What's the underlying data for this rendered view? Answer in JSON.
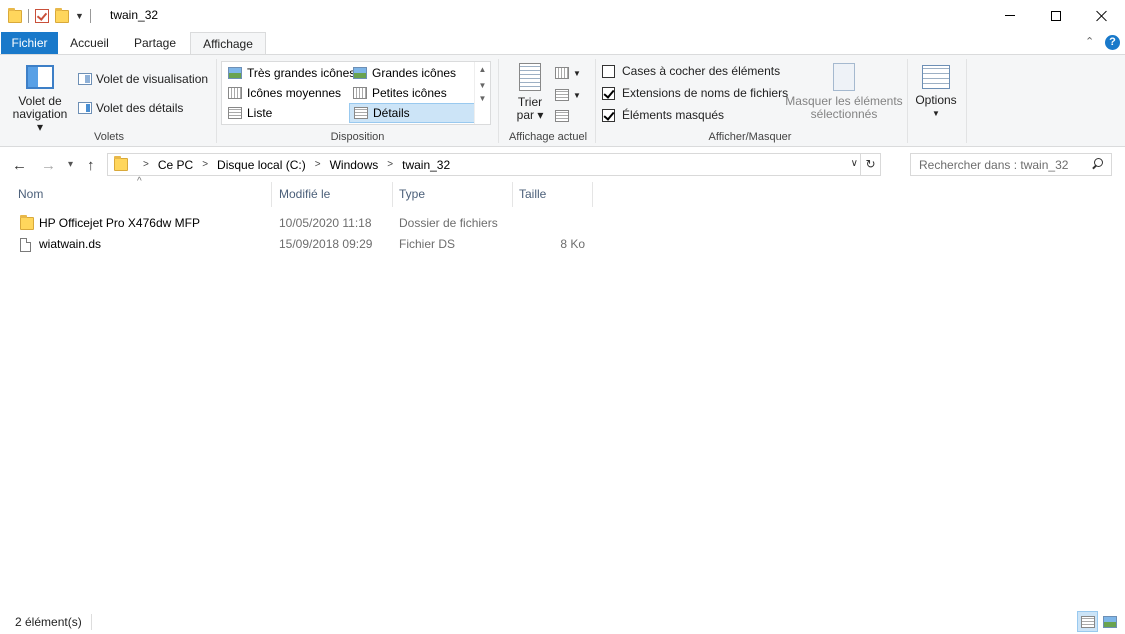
{
  "window": {
    "title": "twain_32"
  },
  "tabs": [
    {
      "label": "Fichier"
    },
    {
      "label": "Accueil"
    },
    {
      "label": "Partage"
    },
    {
      "label": "Affichage"
    }
  ],
  "ribbon": {
    "volets": {
      "nav_pane": "Volet de",
      "nav_pane_2": "navigation",
      "preview_pane": "Volet de visualisation",
      "details_pane": "Volet des détails",
      "group_label": "Volets"
    },
    "disposition": {
      "items": [
        "Très grandes icônes",
        "Grandes icônes",
        "Icônes moyennes",
        "Petites icônes",
        "Liste",
        "Détails"
      ],
      "selected": "Détails",
      "group_label": "Disposition"
    },
    "current_view": {
      "sort_label": "Trier",
      "sort_label_2": "par",
      "group_label": "Affichage actuel"
    },
    "show_hide": {
      "checkboxes": [
        {
          "label": "Cases à cocher des éléments",
          "checked": false
        },
        {
          "label": "Extensions de noms de fichiers",
          "checked": true
        },
        {
          "label": "Éléments masqués",
          "checked": true
        }
      ],
      "hide_selected": "Masquer les éléments",
      "hide_selected_2": "sélectionnés",
      "group_label": "Afficher/Masquer"
    },
    "options": {
      "label": "Options"
    }
  },
  "address": {
    "crumbs": [
      "Ce PC",
      "Disque local (C:)",
      "Windows",
      "twain_32"
    ]
  },
  "search": {
    "placeholder": "Rechercher dans : twain_32"
  },
  "columns": {
    "name": "Nom",
    "modified": "Modifié le",
    "type": "Type",
    "size": "Taille"
  },
  "files": [
    {
      "name": "HP Officejet Pro X476dw MFP",
      "modified": "10/05/2020 11:18",
      "type": "Dossier de fichiers",
      "size": "",
      "icon": "folder-icon"
    },
    {
      "name": "wiatwain.ds",
      "modified": "15/09/2018 09:29",
      "type": "Fichier DS",
      "size": "8 Ko",
      "icon": "file-icon"
    }
  ],
  "status": {
    "count": "2 élément(s)"
  },
  "colors": {
    "accent": "#1979ca",
    "selection": "#cce4f7",
    "folder": "#ffd65c"
  }
}
